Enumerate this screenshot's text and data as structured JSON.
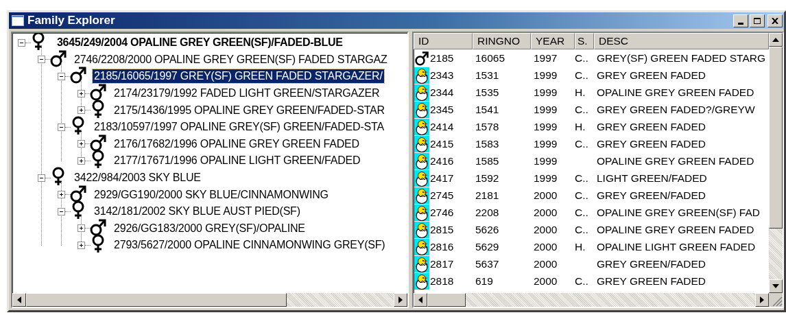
{
  "window": {
    "title": "Family Explorer"
  },
  "tree": [
    {
      "label": "3645/249/2004 OPALINE GREY GREEN(SF)/FADED-BLUE",
      "kind": "female",
      "expanded": true,
      "selected": false,
      "children": [
        {
          "label": "2746/2208/2000 OPALINE GREY GREEN(SF) FADED STARGAZ",
          "kind": "male",
          "expanded": true,
          "selected": false,
          "children": [
            {
              "label": "2185/16065/1997 GREY(SF) GREEN FADED STARGAZER/",
              "kind": "male",
              "expanded": true,
              "selected": true,
              "children": [
                {
                  "label": "2174/23179/1992 FADED LIGHT GREEN/STARGAZER",
                  "kind": "male",
                  "expanded": false,
                  "selected": false
                },
                {
                  "label": "2175/1436/1995 OPALINE GREY GREEN/FADED-STAR",
                  "kind": "female",
                  "expanded": false,
                  "selected": false
                }
              ]
            },
            {
              "label": "2183/10597/1997 OPALINE GREY(SF) GREEN/FADED-STA",
              "kind": "female",
              "expanded": true,
              "selected": false,
              "children": [
                {
                  "label": "2176/17682/1996 OPALINE GREY GREEN FADED",
                  "kind": "male",
                  "expanded": false,
                  "selected": false
                },
                {
                  "label": "2177/17671/1996 OPALINE LIGHT GREEN/FADED",
                  "kind": "female",
                  "expanded": false,
                  "selected": false
                }
              ]
            }
          ]
        },
        {
          "label": "3422/984/2003 SKY BLUE",
          "kind": "female",
          "expanded": true,
          "selected": false,
          "children": [
            {
              "label": "2929/GG190/2000 SKY BLUE/CINNAMONWING",
              "kind": "male",
              "expanded": false,
              "selected": false
            },
            {
              "label": "3142/181/2002 SKY BLUE AUST PIED(SF)",
              "kind": "female",
              "expanded": true,
              "selected": false,
              "children": [
                {
                  "label": "2926/GG183/2000 GREY(SF)/OPALINE",
                  "kind": "male",
                  "expanded": false,
                  "selected": false
                },
                {
                  "label": "2793/5627/2000 OPALINE CINNAMONWING GREY(SF)",
                  "kind": "female",
                  "expanded": false,
                  "selected": false
                }
              ]
            }
          ]
        }
      ]
    }
  ],
  "list": {
    "columns": [
      "ID",
      "RINGNO",
      "YEAR",
      "S.",
      "DESC"
    ],
    "rows": [
      {
        "kind": "male",
        "id": "2185",
        "ringno": "16065",
        "year": "1997",
        "s": "C..",
        "desc": "GREY(SF) GREEN FADED STARG"
      },
      {
        "kind": "chick",
        "id": "2343",
        "ringno": "1531",
        "year": "1999",
        "s": "C..",
        "desc": "GREY GREEN FADED"
      },
      {
        "kind": "chick",
        "id": "2344",
        "ringno": "1535",
        "year": "1999",
        "s": "H.",
        "desc": "OPALINE GREY GREEN FADED"
      },
      {
        "kind": "chick",
        "id": "2345",
        "ringno": "1541",
        "year": "1999",
        "s": "C..",
        "desc": "GREY GREEN FADED?/GREYW"
      },
      {
        "kind": "chick",
        "id": "2414",
        "ringno": "1578",
        "year": "1999",
        "s": "H.",
        "desc": "GREY GREEN FADED"
      },
      {
        "kind": "chick",
        "id": "2415",
        "ringno": "1583",
        "year": "1999",
        "s": "C..",
        "desc": "GREY GREEN FADED"
      },
      {
        "kind": "chick",
        "id": "2416",
        "ringno": "1585",
        "year": "1999",
        "desc": "OPALINE GREY GREEN FADED"
      },
      {
        "kind": "chick",
        "id": "2417",
        "ringno": "1592",
        "year": "1999",
        "s": "C..",
        "desc": "LIGHT GREEN/FADED"
      },
      {
        "kind": "chick",
        "id": "2745",
        "ringno": "2181",
        "year": "2000",
        "s": "C..",
        "desc": "GREY GREEN/FADED"
      },
      {
        "kind": "chick",
        "id": "2746",
        "ringno": "2208",
        "year": "2000",
        "s": "C..",
        "desc": "OPALINE GREY GREEN(SF) FAD"
      },
      {
        "kind": "chick",
        "id": "2815",
        "ringno": "5626",
        "year": "2000",
        "s": "C..",
        "desc": "OPALINE GREY GREEN FADED"
      },
      {
        "kind": "chick",
        "id": "2816",
        "ringno": "5629",
        "year": "2000",
        "s": "H.",
        "desc": "OPALINE LIGHT GREEN FADED"
      },
      {
        "kind": "chick",
        "id": "2817",
        "ringno": "5637",
        "year": "2000",
        "desc": "GREY GREEN/FADED"
      },
      {
        "kind": "chick",
        "id": "2818",
        "ringno": "619",
        "year": "2000",
        "s": "C..",
        "desc": "GREY GREEN FADED"
      }
    ]
  }
}
